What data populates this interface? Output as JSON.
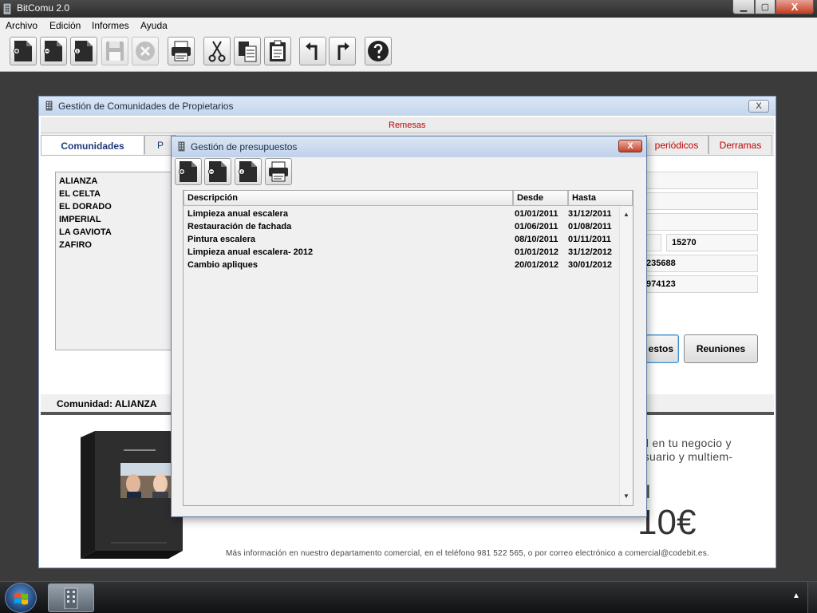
{
  "app": {
    "title": "BitComu 2.0"
  },
  "window_controls": {
    "minimize": "▁",
    "maximize": "▢",
    "close": "X"
  },
  "menu": {
    "items": [
      "Archivo",
      "Edición",
      "Informes",
      "Ayuda"
    ]
  },
  "toolbar": {
    "icons": [
      "new-doc-icon",
      "delete-doc-icon",
      "info-doc-icon",
      "save-icon",
      "cancel-icon",
      "print-icon",
      "cut-icon",
      "copy-icon",
      "paste-icon",
      "undo-icon",
      "redo-icon",
      "help-icon"
    ]
  },
  "comunidades_window": {
    "title": "Gestión de Comunidades de Propietarios",
    "close": "X",
    "remesas": "Remesas",
    "tabs": {
      "comunidades": "Comunidades",
      "p": "P",
      "periodicos": "periódicos",
      "derramas": "Derramas"
    },
    "list": [
      "ALIANZA",
      "EL CELTA",
      "EL DORADO",
      "IMPERIAL",
      "LA GAVIOTA",
      "ZAFIRO"
    ],
    "fields": {
      "postal_code": "15270",
      "phone": "235688",
      "fax": "974123"
    },
    "buttons": {
      "presupuestos_partial": "estos",
      "reuniones": "Reuniones"
    },
    "status": "Comunidad: ALIANZA"
  },
  "ad": {
    "line1": "cial en tu negocio y",
    "line2": "tiusuario y multiem-",
    "pipe": "I",
    "price": "10€",
    "info": "Más información en nuestro departamento comercial, en el teléfono 981 522 565, o por correo electrónico a comercial@codebit.es."
  },
  "presupuestos": {
    "title": "Gestión de presupuestos",
    "close": "X",
    "toolbar_icons": [
      "new-doc-icon",
      "delete-doc-icon",
      "info-doc-icon",
      "print-icon"
    ],
    "columns": {
      "descripcion": "Descripción",
      "desde": "Desde",
      "hasta": "Hasta"
    },
    "rows": [
      {
        "descripcion": "Limpieza anual escalera",
        "desde": "01/01/2011",
        "hasta": "31/12/2011"
      },
      {
        "descripcion": "Restauración de fachada",
        "desde": "01/06/2011",
        "hasta": "01/08/2011"
      },
      {
        "descripcion": "Pintura escalera",
        "desde": "08/10/2011",
        "hasta": "01/11/2011"
      },
      {
        "descripcion": "Limpieza anual escalera- 2012",
        "desde": "01/01/2012",
        "hasta": "31/12/2012"
      },
      {
        "descripcion": "Cambio apliques",
        "desde": "20/01/2012",
        "hasta": "30/01/2012"
      }
    ],
    "scroll": {
      "up": "▲",
      "down": "▼"
    }
  },
  "taskbar": {
    "tray_arrow": "▲"
  },
  "colors": {
    "accent_red": "#c00000",
    "tab_blue": "#1d3b7a",
    "title_blue": "#c4d5ec"
  }
}
